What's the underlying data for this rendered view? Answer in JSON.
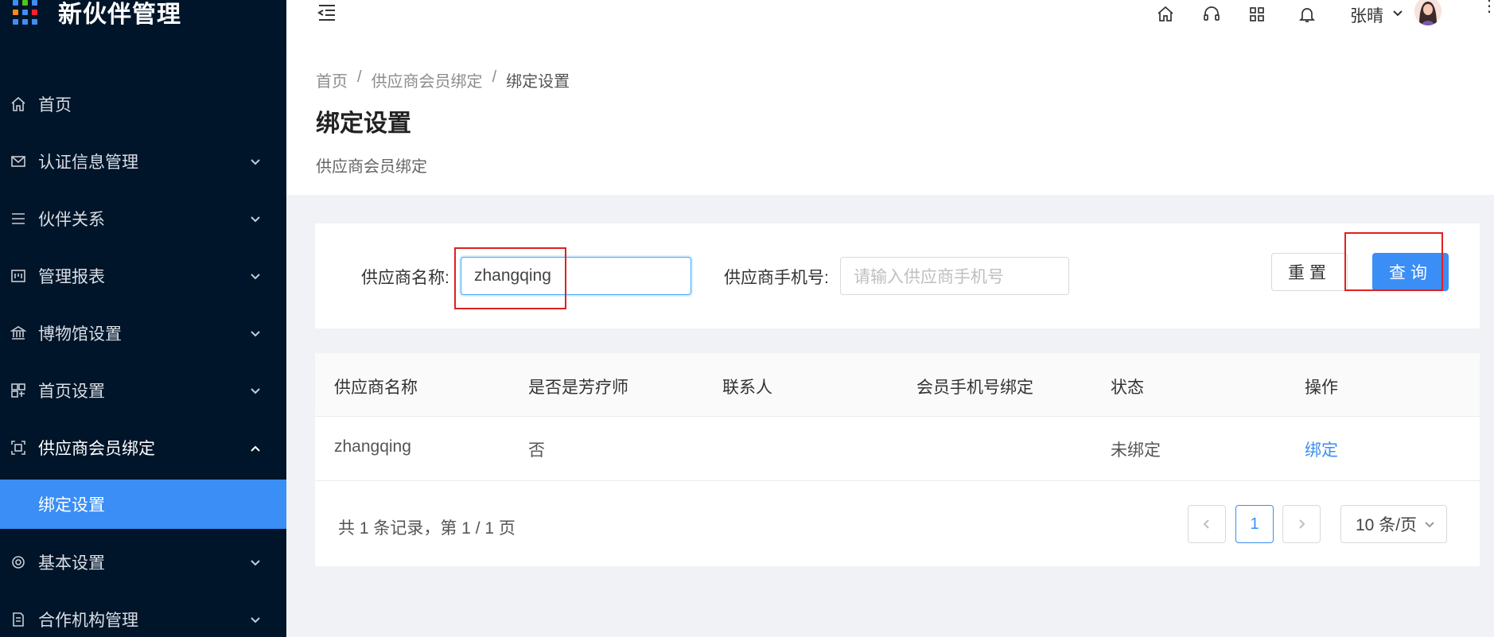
{
  "app": {
    "title": "新伙伴管理"
  },
  "sidebar": {
    "items": [
      {
        "label": "首页",
        "icon": "home-icon"
      },
      {
        "label": "认证信息管理",
        "icon": "mail-icon"
      },
      {
        "label": "伙伴关系",
        "icon": "list-icon"
      },
      {
        "label": "管理报表",
        "icon": "report-icon"
      },
      {
        "label": "博物馆设置",
        "icon": "bank-icon"
      },
      {
        "label": "首页设置",
        "icon": "layout-icon"
      },
      {
        "label": "供应商会员绑定",
        "icon": "scan-icon",
        "expanded": true
      },
      {
        "label": "基本设置",
        "icon": "gear-icon"
      },
      {
        "label": "合作机构管理",
        "icon": "doc-icon"
      }
    ],
    "active_sub": "绑定设置"
  },
  "header": {
    "user_name": "张晴",
    "icons": [
      "home-icon",
      "headset-icon",
      "apps-icon",
      "bell-icon"
    ]
  },
  "page": {
    "breadcrumb": [
      "首页",
      "供应商会员绑定",
      "绑定设置"
    ],
    "title": "绑定设置",
    "description": "供应商会员绑定"
  },
  "search": {
    "name_label": "供应商名称:",
    "name_value": "zhangqing",
    "phone_label": "供应商手机号:",
    "phone_placeholder": "请输入供应商手机号",
    "reset_label": "重置",
    "query_label": "查询"
  },
  "table": {
    "columns": [
      "供应商名称",
      "是否是芳疗师",
      "联系人",
      "会员手机号绑定",
      "状态",
      "操作"
    ],
    "rows": [
      {
        "name": "zhangqing",
        "is_therapist": "否",
        "contact": "",
        "phone_bound": "",
        "status": "未绑定",
        "action": "绑定"
      }
    ]
  },
  "pagination": {
    "summary": "共 1 条记录，第 1 / 1 页",
    "current_page": "1",
    "page_size": "10 条/页"
  },
  "colors": {
    "sidebar_bg": "#001529",
    "accent": "#3a8ef6",
    "highlight_box": "#e02020"
  }
}
